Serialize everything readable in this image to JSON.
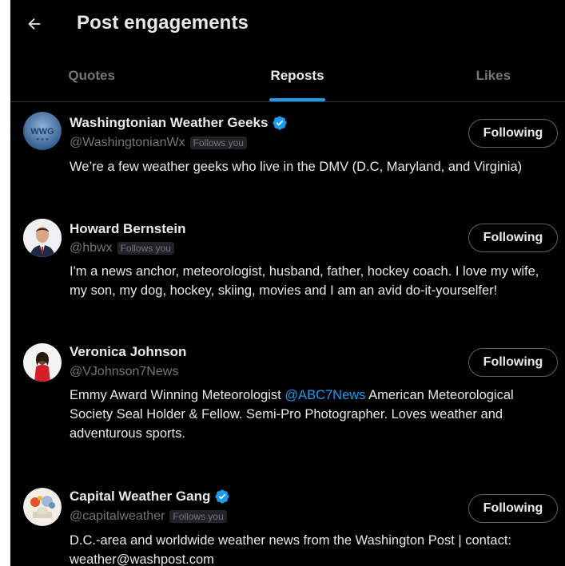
{
  "header": {
    "title": "Post engagements",
    "back_icon": "arrow-left-icon"
  },
  "tabs": [
    {
      "label": "Quotes",
      "active": false
    },
    {
      "label": "Reposts",
      "active": true
    },
    {
      "label": "Likes",
      "active": false
    }
  ],
  "colors": {
    "background": "#000000",
    "accent": "#1d9bf0",
    "text": "#e7e9ea",
    "muted": "#71767b"
  },
  "users": [
    {
      "name": "Washingtonian Weather Geeks",
      "verified": true,
      "handle": "@WashingtonianWx",
      "follows_you": "Follows you",
      "bio": "We’re a few weather geeks who live in the DMV (D.C, Maryland, and Virginia)",
      "button": "Following",
      "avatar_text": "WWG"
    },
    {
      "name": "Howard Bernstein",
      "verified": false,
      "handle": "@hbwx",
      "follows_you": "Follows you",
      "bio": "I'm a news anchor, meteorologist, husband, father, hockey coach. I love my wife, my son, my dog, hockey, skiing, movies and I am an avid do-it-yourselfer!",
      "button": "Following"
    },
    {
      "name": "Veronica Johnson",
      "verified": false,
      "handle": "@VJohnson7News",
      "bio_before": "Emmy Award Winning Meteorologist ",
      "bio_mention": "@ABC7News",
      "bio_after": " American Meteorological Society Seal Holder & Fellow. Semi-Pro Photographer. Loves weather and adventurous sports.",
      "button": "Following"
    },
    {
      "name": "Capital Weather Gang",
      "verified": true,
      "handle": "@capitalweather",
      "follows_you": "Follows you",
      "bio": "D.C.-area and worldwide weather news from the Washington Post | contact: weather@washpost.com",
      "button": "Following"
    }
  ]
}
